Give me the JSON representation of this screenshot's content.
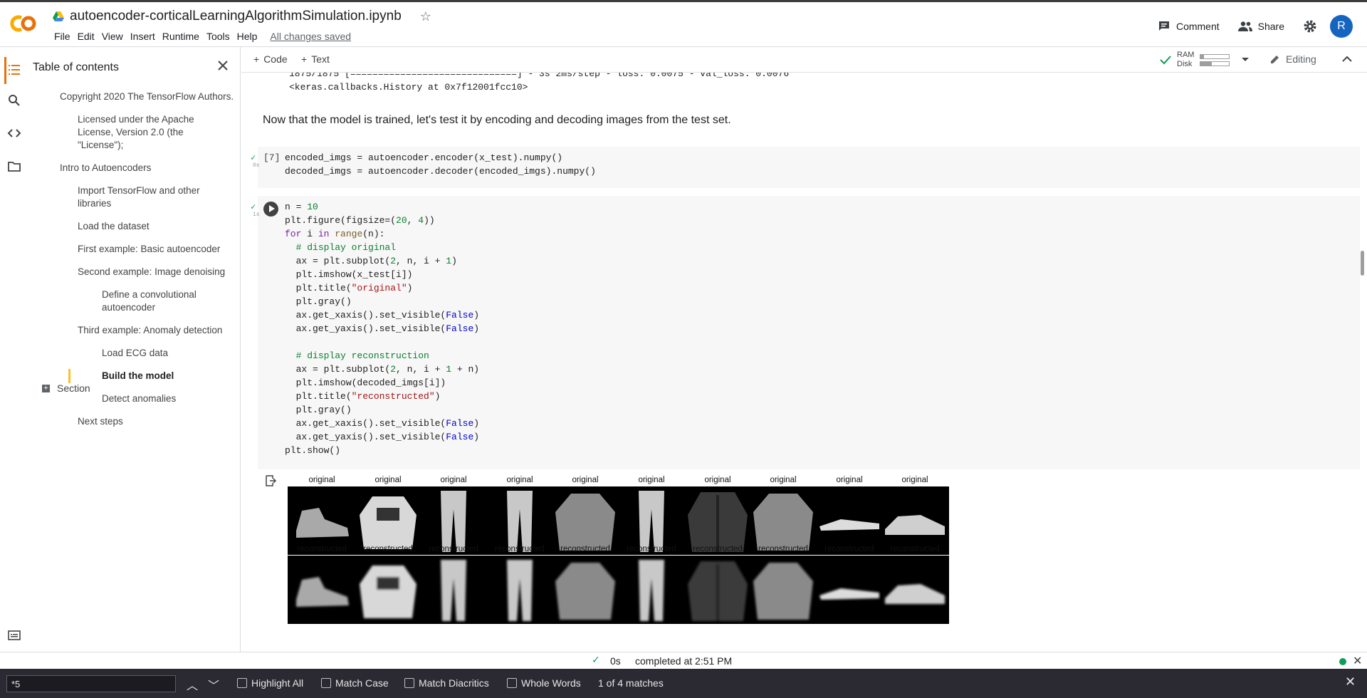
{
  "header": {
    "title": "autoencoder-corticalLearningAlgorithmSimulation.ipynb",
    "menu": [
      "File",
      "Edit",
      "View",
      "Insert",
      "Runtime",
      "Tools",
      "Help"
    ],
    "saved_status": "All changes saved",
    "comment_label": "Comment",
    "share_label": "Share",
    "avatar_letter": "R"
  },
  "toc": {
    "heading": "Table of contents",
    "items": [
      {
        "label": "Copyright 2020 The TensorFlow Authors.",
        "level": 1
      },
      {
        "label": "Licensed under the Apache License, Version 2.0 (the \"License\");",
        "level": 2
      },
      {
        "label": "Intro to Autoencoders",
        "level": 1
      },
      {
        "label": "Import TensorFlow and other libraries",
        "level": 2
      },
      {
        "label": "Load the dataset",
        "level": 2
      },
      {
        "label": "First example: Basic autoencoder",
        "level": 2
      },
      {
        "label": "Second example: Image denoising",
        "level": 2
      },
      {
        "label": "Define a convolutional autoencoder",
        "level": 3
      },
      {
        "label": "Third example: Anomaly detection",
        "level": 2
      },
      {
        "label": "Load ECG data",
        "level": 3
      },
      {
        "label": "Build the model",
        "level": 3
      },
      {
        "label": "Detect anomalies",
        "level": 3
      },
      {
        "label": "Next steps",
        "level": 2
      }
    ],
    "section_label": "Section"
  },
  "toolbar": {
    "code_label": "Code",
    "text_label": "Text",
    "ram_label": "RAM",
    "disk_label": "Disk",
    "ram_fraction": 0.12,
    "disk_fraction": 0.4,
    "editing_label": "Editing"
  },
  "notebook": {
    "prev_output": [
      "1875/1875 [==============================] - 3s 2ms/step - loss: 0.0075 - val_loss: 0.0076",
      "<keras.callbacks.History at 0x7f12001fcc10>"
    ],
    "markdown": "Now that the model is trained, let's test it by encoding and decoding images from the test set.",
    "cell7": {
      "exec_count": "[7]",
      "duration": "0s",
      "lines": [
        "encoded_imgs = autoencoder.encoder(x_test).numpy()",
        "decoded_imgs = autoencoder.decoder(encoded_imgs).numpy()"
      ]
    },
    "cell8": {
      "duration": "1s"
    },
    "output_titles": {
      "top": "original",
      "bottom": "reconstructed"
    },
    "items": [
      "ankle-boot",
      "pullover",
      "trouser",
      "trouser",
      "shirt",
      "trouser",
      "coat",
      "shirt",
      "sandal",
      "sneaker"
    ]
  },
  "status": {
    "time": "0s",
    "message": "completed at 2:51 PM"
  },
  "findbar": {
    "query": "*5",
    "highlight_all": "Highlight All",
    "match_case": "Match Case",
    "match_diacritics": "Match Diacritics",
    "whole_words": "Whole Words",
    "count": "1 of 4 matches"
  }
}
